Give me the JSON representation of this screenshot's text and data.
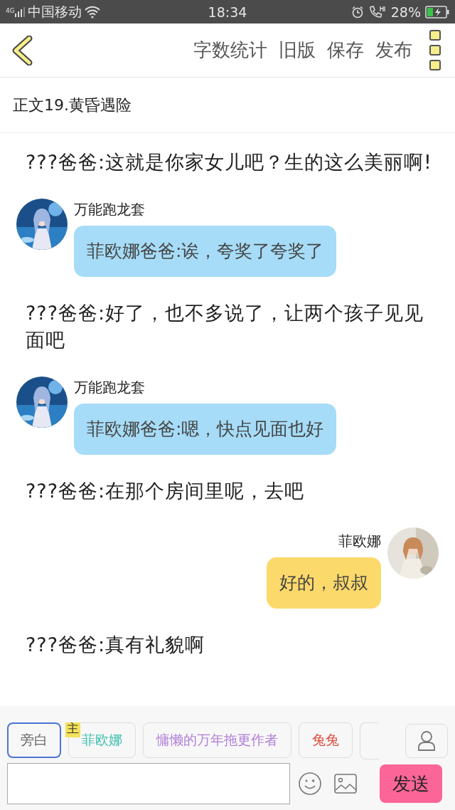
{
  "status_bar": {
    "network": "4G",
    "carrier": "中国移动",
    "time": "18:34",
    "battery": "28%"
  },
  "toolbar": {
    "actions": [
      "字数统计",
      "旧版",
      "保存",
      "发布"
    ]
  },
  "chapter_title": "正文19.黄昏遇险",
  "messages": [
    {
      "kind": "narration",
      "text": "???爸爸:这就是你家女儿吧？生的这么美丽啊!"
    },
    {
      "kind": "left",
      "name": "万能跑龙套",
      "text": "菲欧娜爸爸:诶，夸奖了夸奖了"
    },
    {
      "kind": "narration",
      "text": "???爸爸:好了，也不多说了，让两个孩子见见面吧"
    },
    {
      "kind": "left",
      "name": "万能跑龙套",
      "text": "菲欧娜爸爸:嗯，快点见面也好"
    },
    {
      "kind": "narration",
      "text": "???爸爸:在那个房间里呢，去吧"
    },
    {
      "kind": "right",
      "name": "菲欧娜",
      "text": "好的，叔叔"
    },
    {
      "kind": "narration",
      "text": "???爸爸:真有礼貌啊"
    }
  ],
  "speakers": [
    {
      "label": "旁白",
      "selected": true,
      "color": "#666666"
    },
    {
      "label": "菲欧娜",
      "selected": false,
      "color": "#3cbfae",
      "badge": "主"
    },
    {
      "label": "慵懒的万年拖更作者",
      "selected": false,
      "color": "#b07fd8"
    },
    {
      "label": "兔兔",
      "selected": false,
      "color": "#e0483a"
    }
  ],
  "send_button": "发送"
}
